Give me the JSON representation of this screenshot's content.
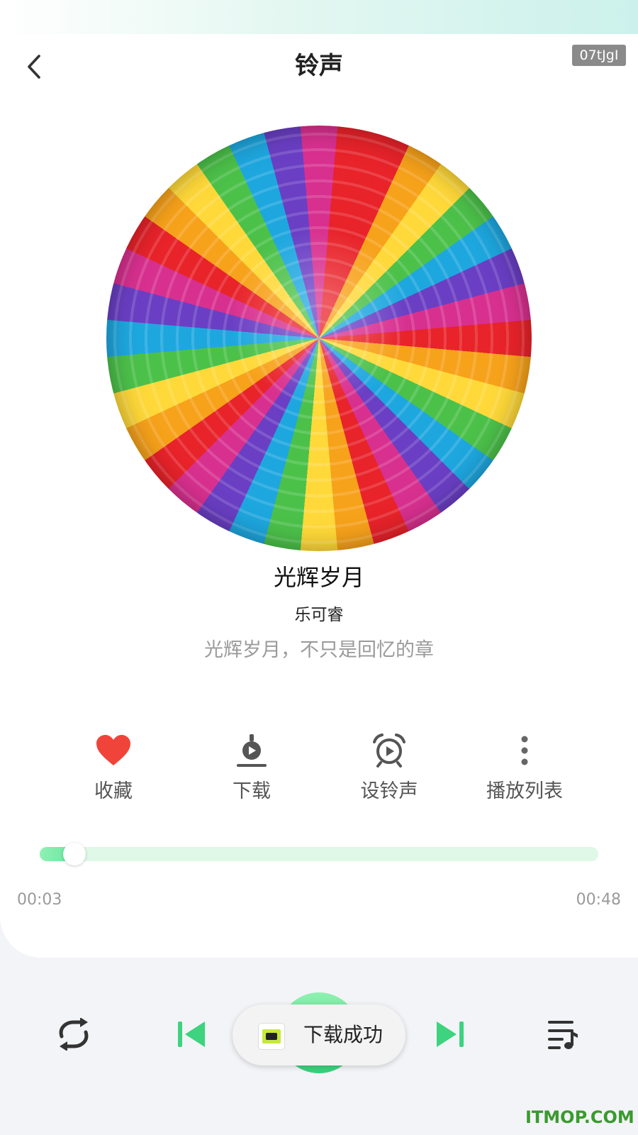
{
  "header": {
    "title": "铃声",
    "tag": "07tJgI"
  },
  "song": {
    "title": "光辉岁月",
    "artist": "乐可睿",
    "description": "光辉岁月，不只是回忆的章"
  },
  "actions": [
    {
      "label": "收藏",
      "icon": "heart-icon"
    },
    {
      "label": "下载",
      "icon": "download-icon"
    },
    {
      "label": "设铃声",
      "icon": "alarm-ringtone-icon"
    },
    {
      "label": "播放列表",
      "icon": "more-vertical-icon"
    }
  ],
  "player": {
    "current_time": "00:03",
    "total_time": "00:48",
    "progress": 0.0625
  },
  "controls": {
    "loop": "repeat-icon",
    "prev": "skip-previous-icon",
    "play": "play-pause-icon",
    "next": "skip-next-icon",
    "playlist": "playlist-music-icon"
  },
  "toast": {
    "text": "下载成功",
    "icon": "app-icon"
  },
  "watermark": "ITMOP.COM",
  "colors": {
    "accent": "#3dd37f",
    "heart": "#f0443a",
    "track": "#dff8e8"
  }
}
